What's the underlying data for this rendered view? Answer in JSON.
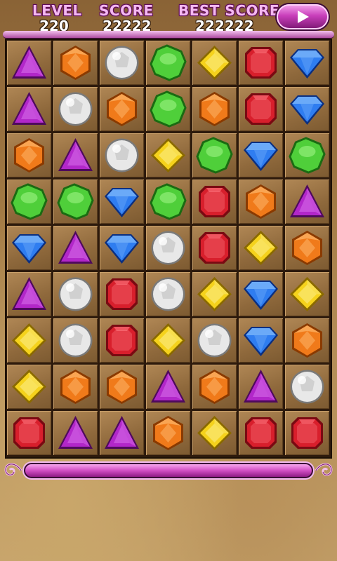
{
  "hud": {
    "level_label": "LEVEL",
    "level_value": "220",
    "score_label": "SCORE",
    "score_value": "22222",
    "best_label": "BEST SCORE",
    "best_value": "222222",
    "play_icon": "play-arrow-icon"
  },
  "board": {
    "columns": 7,
    "rows": 9,
    "grid": [
      [
        "purple",
        "orange",
        "white",
        "green",
        "yellow",
        "red",
        "blue"
      ],
      [
        "purple",
        "white",
        "orange",
        "green",
        "orange",
        "red",
        "blue"
      ],
      [
        "orange",
        "purple",
        "white",
        "yellow",
        "green",
        "blue",
        "green"
      ],
      [
        "green",
        "green",
        "blue",
        "green",
        "red",
        "orange",
        "purple"
      ],
      [
        "blue",
        "purple",
        "blue",
        "white",
        "red",
        "yellow",
        "orange"
      ],
      [
        "purple",
        "white",
        "red",
        "white",
        "yellow",
        "blue",
        "yellow"
      ],
      [
        "yellow",
        "white",
        "red",
        "yellow",
        "white",
        "blue",
        "orange"
      ],
      [
        "yellow",
        "orange",
        "orange",
        "purple",
        "orange",
        "purple",
        "white"
      ],
      [
        "red",
        "purple",
        "purple",
        "orange",
        "yellow",
        "red",
        "red"
      ]
    ]
  },
  "progress": {
    "fraction": 1.0
  },
  "colors": {
    "hud_label": "#f4b8f1",
    "accent": "#c93fbb",
    "gem_red": "#d81f2c",
    "gem_blue": "#2f7df0",
    "gem_green": "#4fcf3a",
    "gem_yellow": "#f5d21c",
    "gem_orange": "#f07a1a",
    "gem_purple": "#b227c9",
    "gem_white": "#e8e8e8"
  }
}
